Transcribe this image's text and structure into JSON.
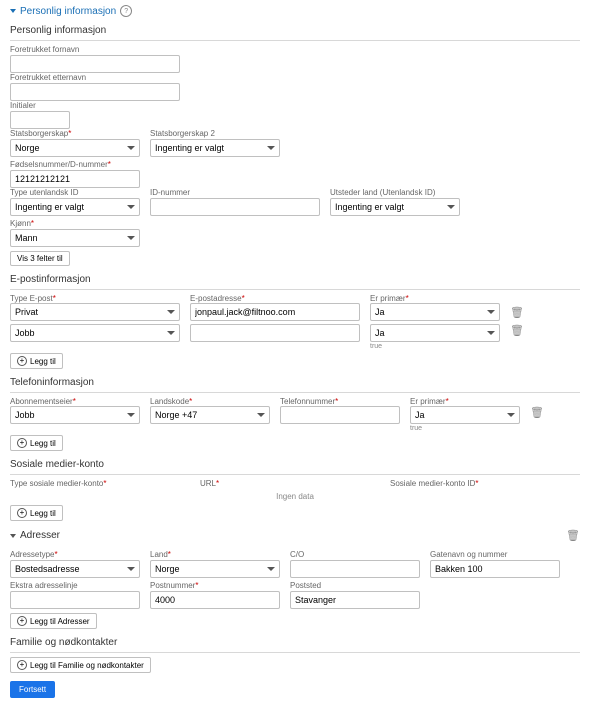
{
  "panel": {
    "title": "Personlig informasjon"
  },
  "personal": {
    "header": "Personlig informasjon",
    "pref_first_label": "Foretrukket fornavn",
    "pref_last_label": "Foretrukket etternavn",
    "initials_label": "Initialer",
    "citizenship_label": "Statsborgerskap",
    "citizenship_value": "Norge",
    "citizenship2_label": "Statsborgerskap 2",
    "citizenship2_value": "Ingenting er valgt",
    "ssn_label": "Fødselsnummer/D-nummer",
    "ssn_value": "12121212121",
    "foreign_id_type_label": "Type utenlandsk ID",
    "foreign_id_type_value": "Ingenting er valgt",
    "foreign_id_number_label": "ID-nummer",
    "issuer_country_label": "Utsteder land (Utenlandsk ID)",
    "issuer_country_value": "Ingenting er valgt",
    "gender_label": "Kjønn",
    "gender_value": "Mann",
    "show_more_label": "Vis 3 felter til"
  },
  "email": {
    "header": "E-postinformasjon",
    "type_label": "Type E-post",
    "address_label": "E-postadresse",
    "primary_label": "Er primær",
    "rows": [
      {
        "type": "Privat",
        "address": "jonpaul.jack@filtnoo.com",
        "primary": "Ja",
        "hint": ""
      },
      {
        "type": "Jobb",
        "address": "",
        "primary": "Ja",
        "hint": "true"
      }
    ],
    "add_label": "Legg til"
  },
  "phone": {
    "header": "Telefoninformasjon",
    "subscription_label": "Abonnementseier",
    "country_code_label": "Landskode",
    "number_label": "Telefonnummer",
    "primary_label": "Er primær",
    "rows": [
      {
        "subscription": "Jobb",
        "country_code": "Norge +47",
        "number": "",
        "primary": "Ja",
        "hint": "true"
      }
    ],
    "add_label": "Legg til"
  },
  "social": {
    "header": "Sosiale medier-konto",
    "type_label": "Type sosiale medier-konto",
    "url_label": "URL",
    "account_id_label": "Sosiale medier-konto ID",
    "no_data": "Ingen data",
    "add_label": "Legg til"
  },
  "addresses": {
    "header": "Adresser",
    "type_label": "Adressetype",
    "country_label": "Land",
    "co_label": "C/O",
    "street_label": "Gatenavn og nummer",
    "extra_line_label": "Ekstra adresselinje",
    "postcode_label": "Postnummer",
    "city_label": "Poststed",
    "row": {
      "type": "Bostedsadresse",
      "country": "Norge",
      "co": "",
      "street": "Bakken 100",
      "extra": "",
      "postcode": "4000",
      "city": "Stavanger"
    },
    "add_label": "Legg til Adresser"
  },
  "family": {
    "header": "Familie og nødkontakter",
    "add_label": "Legg til Familie og nødkontakter"
  },
  "save_label": "Fortsett"
}
